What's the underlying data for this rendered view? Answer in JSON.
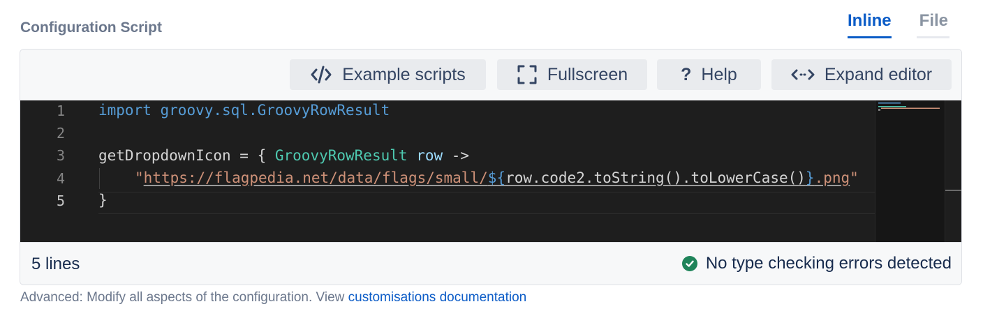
{
  "section": {
    "title": "Configuration Script"
  },
  "tabs": [
    {
      "label": "Inline",
      "active": true
    },
    {
      "label": "File",
      "active": false
    }
  ],
  "toolbar": {
    "example_scripts": "Example scripts",
    "fullscreen": "Fullscreen",
    "help": "Help",
    "expand_editor": "Expand editor"
  },
  "editor": {
    "line_numbers": [
      "1",
      "2",
      "3",
      "4",
      "5"
    ],
    "line1": {
      "keyword": "import",
      "pkg": "groovy.sql.",
      "cls": "GroovyRowResult"
    },
    "line3": {
      "name": "getDropdownIcon",
      "assign": " = { ",
      "type": "GroovyRowResult",
      "param": "row",
      "arrow": " ->"
    },
    "line4": {
      "quote_open": "\"",
      "url": "https://flagpedia.net/data/flags/small/",
      "interp_open": "${",
      "expr": "row.code2.toString().toLowerCase()",
      "interp_close": "}",
      "ext": ".png",
      "quote_close": "\""
    },
    "line5": {
      "close": "}"
    }
  },
  "status": {
    "lines": "5 lines",
    "type_check": "No type checking errors detected"
  },
  "footer": {
    "text": "Advanced: Modify all aspects of the configuration. View ",
    "link": "customisations documentation"
  },
  "colors": {
    "accent": "#0b5cc7",
    "success": "#1f845a",
    "editor_bg": "#1e1e1e"
  }
}
